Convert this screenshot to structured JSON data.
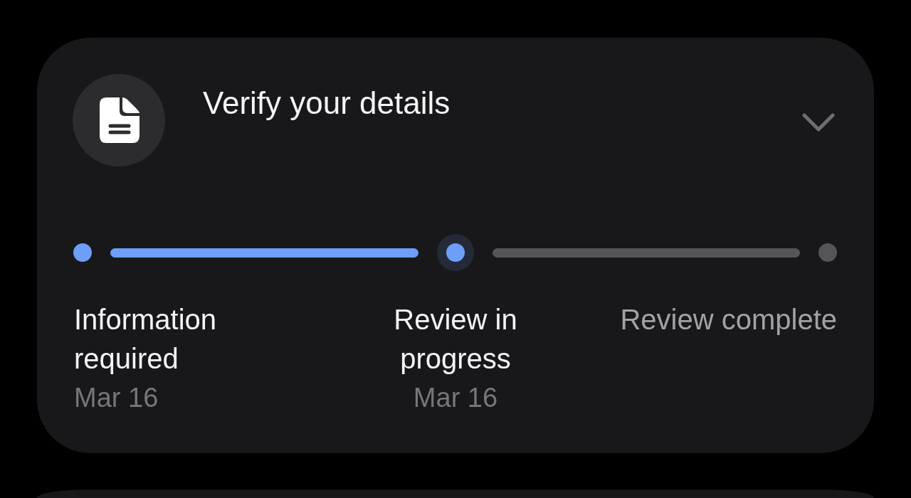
{
  "card": {
    "title": "Verify your details",
    "expanded": false
  },
  "steps": [
    {
      "label": "Information required",
      "date": "Mar 16",
      "done": true,
      "current": false
    },
    {
      "label": "Review in progress",
      "date": "Mar 16",
      "done": false,
      "current": true
    },
    {
      "label": "Review complete",
      "done": false,
      "current": false
    }
  ]
}
